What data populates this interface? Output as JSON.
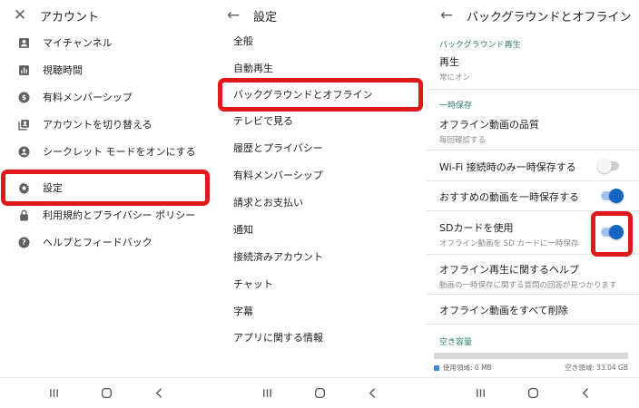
{
  "panel1": {
    "title": "アカウント",
    "items": [
      {
        "label": "マイチャンネル",
        "icon": "account-box-icon"
      },
      {
        "label": "視聴時間",
        "icon": "bar-chart-icon"
      },
      {
        "label": "有料メンバーシップ",
        "icon": "dollar-circle-icon"
      },
      {
        "label": "アカウントを切り替える",
        "icon": "switch-account-icon"
      },
      {
        "label": "シークレット モードをオンにする",
        "icon": "incognito-icon"
      },
      {
        "label": "設定",
        "icon": "gear-icon"
      },
      {
        "label": "利用規約とプライバシー ポリシー",
        "icon": "lock-icon"
      },
      {
        "label": "ヘルプとフィードバック",
        "icon": "help-circle-icon"
      }
    ]
  },
  "panel2": {
    "title": "設定",
    "items": [
      {
        "label": "全般"
      },
      {
        "label": "自動再生"
      },
      {
        "label": "バックグラウンドとオフライン"
      },
      {
        "label": "テレビで見る"
      },
      {
        "label": "履歴とプライバシー"
      },
      {
        "label": "有料メンバーシップ"
      },
      {
        "label": "請求とお支払い"
      },
      {
        "label": "通知"
      },
      {
        "label": "接続済みアカウント"
      },
      {
        "label": "チャット"
      },
      {
        "label": "字幕"
      },
      {
        "label": "アプリに関する情報"
      }
    ]
  },
  "panel3": {
    "title": "バックグラウンドとオフライン",
    "section_background": "バックグラウンド再生",
    "playback": {
      "title": "再生",
      "subtitle": "常にオン"
    },
    "section_offline": "一時保存",
    "quality": {
      "title": "オフライン動画の品質",
      "subtitle": "毎回確認する"
    },
    "wifi_only": {
      "title": "Wi-Fi 接続時のみ一時保存する",
      "enabled": false
    },
    "recommended": {
      "title": "おすすめの動画を一時保存する",
      "enabled": true
    },
    "sd_card": {
      "title": "SDカードを使用",
      "subtitle": "オフライン動画を SD カードに一時保存",
      "enabled": true
    },
    "help": {
      "title": "オフライン再生に関するヘルプ",
      "subtitle": "動画の一時保存に関する質問の回答が見つかります"
    },
    "delete_all": {
      "title": "オフライン動画をすべて削除"
    },
    "section_storage": "空き容量",
    "storage": {
      "used_label": "使用領域: 0 MB",
      "free_label": "空き領域: 33.04 GB",
      "used_fraction": 0.0
    }
  },
  "colors": {
    "highlight": "#e01a1a",
    "toggle_on": "#1565c0",
    "section_text": "#2e7d6e"
  },
  "bottom_nav_icons": [
    "recents-icon",
    "home-icon",
    "back-icon"
  ]
}
